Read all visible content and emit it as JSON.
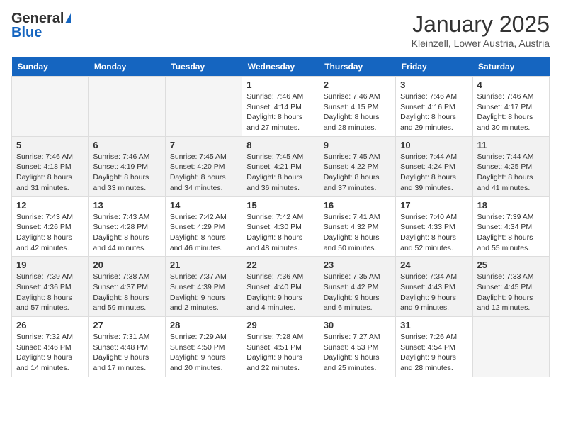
{
  "header": {
    "logo_general": "General",
    "logo_blue": "Blue",
    "month_title": "January 2025",
    "location": "Kleinzell, Lower Austria, Austria"
  },
  "weekdays": [
    "Sunday",
    "Monday",
    "Tuesday",
    "Wednesday",
    "Thursday",
    "Friday",
    "Saturday"
  ],
  "weeks": [
    {
      "days": [
        {
          "num": "",
          "info": ""
        },
        {
          "num": "",
          "info": ""
        },
        {
          "num": "",
          "info": ""
        },
        {
          "num": "1",
          "info": "Sunrise: 7:46 AM\nSunset: 4:14 PM\nDaylight: 8 hours and 27 minutes."
        },
        {
          "num": "2",
          "info": "Sunrise: 7:46 AM\nSunset: 4:15 PM\nDaylight: 8 hours and 28 minutes."
        },
        {
          "num": "3",
          "info": "Sunrise: 7:46 AM\nSunset: 4:16 PM\nDaylight: 8 hours and 29 minutes."
        },
        {
          "num": "4",
          "info": "Sunrise: 7:46 AM\nSunset: 4:17 PM\nDaylight: 8 hours and 30 minutes."
        }
      ]
    },
    {
      "days": [
        {
          "num": "5",
          "info": "Sunrise: 7:46 AM\nSunset: 4:18 PM\nDaylight: 8 hours and 31 minutes."
        },
        {
          "num": "6",
          "info": "Sunrise: 7:46 AM\nSunset: 4:19 PM\nDaylight: 8 hours and 33 minutes."
        },
        {
          "num": "7",
          "info": "Sunrise: 7:45 AM\nSunset: 4:20 PM\nDaylight: 8 hours and 34 minutes."
        },
        {
          "num": "8",
          "info": "Sunrise: 7:45 AM\nSunset: 4:21 PM\nDaylight: 8 hours and 36 minutes."
        },
        {
          "num": "9",
          "info": "Sunrise: 7:45 AM\nSunset: 4:22 PM\nDaylight: 8 hours and 37 minutes."
        },
        {
          "num": "10",
          "info": "Sunrise: 7:44 AM\nSunset: 4:24 PM\nDaylight: 8 hours and 39 minutes."
        },
        {
          "num": "11",
          "info": "Sunrise: 7:44 AM\nSunset: 4:25 PM\nDaylight: 8 hours and 41 minutes."
        }
      ]
    },
    {
      "days": [
        {
          "num": "12",
          "info": "Sunrise: 7:43 AM\nSunset: 4:26 PM\nDaylight: 8 hours and 42 minutes."
        },
        {
          "num": "13",
          "info": "Sunrise: 7:43 AM\nSunset: 4:28 PM\nDaylight: 8 hours and 44 minutes."
        },
        {
          "num": "14",
          "info": "Sunrise: 7:42 AM\nSunset: 4:29 PM\nDaylight: 8 hours and 46 minutes."
        },
        {
          "num": "15",
          "info": "Sunrise: 7:42 AM\nSunset: 4:30 PM\nDaylight: 8 hours and 48 minutes."
        },
        {
          "num": "16",
          "info": "Sunrise: 7:41 AM\nSunset: 4:32 PM\nDaylight: 8 hours and 50 minutes."
        },
        {
          "num": "17",
          "info": "Sunrise: 7:40 AM\nSunset: 4:33 PM\nDaylight: 8 hours and 52 minutes."
        },
        {
          "num": "18",
          "info": "Sunrise: 7:39 AM\nSunset: 4:34 PM\nDaylight: 8 hours and 55 minutes."
        }
      ]
    },
    {
      "days": [
        {
          "num": "19",
          "info": "Sunrise: 7:39 AM\nSunset: 4:36 PM\nDaylight: 8 hours and 57 minutes."
        },
        {
          "num": "20",
          "info": "Sunrise: 7:38 AM\nSunset: 4:37 PM\nDaylight: 8 hours and 59 minutes."
        },
        {
          "num": "21",
          "info": "Sunrise: 7:37 AM\nSunset: 4:39 PM\nDaylight: 9 hours and 2 minutes."
        },
        {
          "num": "22",
          "info": "Sunrise: 7:36 AM\nSunset: 4:40 PM\nDaylight: 9 hours and 4 minutes."
        },
        {
          "num": "23",
          "info": "Sunrise: 7:35 AM\nSunset: 4:42 PM\nDaylight: 9 hours and 6 minutes."
        },
        {
          "num": "24",
          "info": "Sunrise: 7:34 AM\nSunset: 4:43 PM\nDaylight: 9 hours and 9 minutes."
        },
        {
          "num": "25",
          "info": "Sunrise: 7:33 AM\nSunset: 4:45 PM\nDaylight: 9 hours and 12 minutes."
        }
      ]
    },
    {
      "days": [
        {
          "num": "26",
          "info": "Sunrise: 7:32 AM\nSunset: 4:46 PM\nDaylight: 9 hours and 14 minutes."
        },
        {
          "num": "27",
          "info": "Sunrise: 7:31 AM\nSunset: 4:48 PM\nDaylight: 9 hours and 17 minutes."
        },
        {
          "num": "28",
          "info": "Sunrise: 7:29 AM\nSunset: 4:50 PM\nDaylight: 9 hours and 20 minutes."
        },
        {
          "num": "29",
          "info": "Sunrise: 7:28 AM\nSunset: 4:51 PM\nDaylight: 9 hours and 22 minutes."
        },
        {
          "num": "30",
          "info": "Sunrise: 7:27 AM\nSunset: 4:53 PM\nDaylight: 9 hours and 25 minutes."
        },
        {
          "num": "31",
          "info": "Sunrise: 7:26 AM\nSunset: 4:54 PM\nDaylight: 9 hours and 28 minutes."
        },
        {
          "num": "",
          "info": ""
        }
      ]
    }
  ]
}
